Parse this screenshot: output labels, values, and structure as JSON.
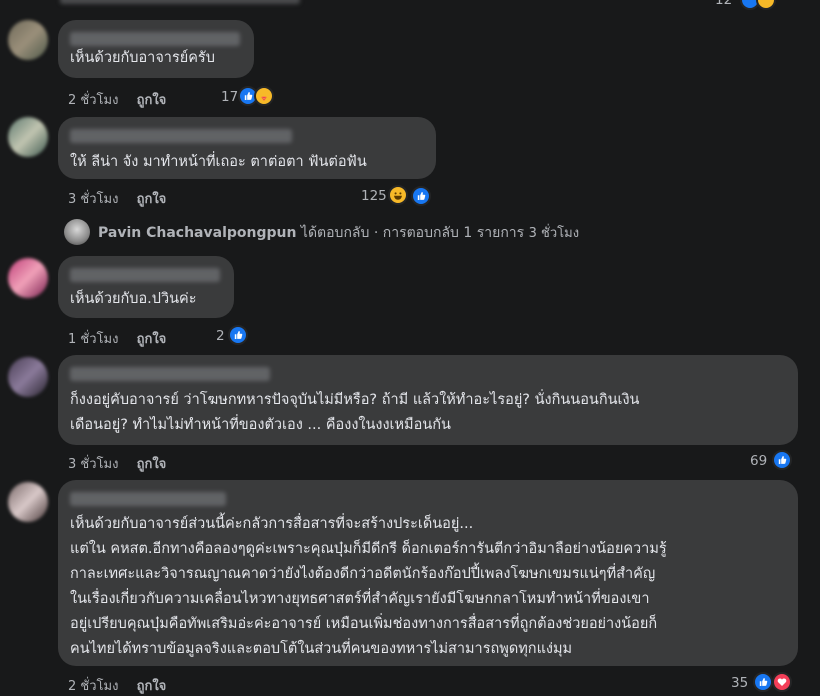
{
  "comments": [
    {
      "text": [
        "เห็นด้วยกับอาจารย์ครับ"
      ],
      "time": "2 ชั่วโมง",
      "like": "ถูกใจ",
      "count": "17"
    },
    {
      "text": [
        "ให้ ลีน่า จัง มาทำหน้าที่เถอะ ตาต่อตา ฟันต่อฟัน"
      ],
      "time": "3 ชั่วโมง",
      "like": "ถูกใจ",
      "count": "125"
    },
    {
      "text": [
        "เห็นด้วยกับอ.ปวินค่ะ"
      ],
      "time": "1 ชั่วโมง",
      "like": "ถูกใจ",
      "count": "2"
    },
    {
      "text": [
        "ก็งงอยู่คับอาจารย์ ว่าโฆษกทหารปัจจุบันไม่มีหรือ? ถ้ามี แล้วให้ทำอะไรอยู่? นั่งกินนอนกินเงิน",
        "เดือนอยู่? ทำไมไม่ทำหน้าที่ของตัวเอง ... คืองงในงงเหมือนกัน"
      ],
      "time": "3 ชั่วโมง",
      "like": "ถูกใจ",
      "count": "69"
    },
    {
      "text": [
        "เห็นด้วยกับอาจารย์ส่วนนี้ค่ะกลัวการสื่อสารที่จะสร้างประเด็นอยู่...",
        "แต่ใน คหสต.อีกทางคือลองๆดูค่ะเพราะคุณบุ๋มก็มีดีกรี ด็อกเตอร์การันตีกว่าอิมาลือย่างน้อยความรู้",
        "กาละเทศะและวิจารณญาณคาดว่ายังไงต้องดีกว่าอดีตนักร้องก๊อปปี้เพลงโฆษกเขมรแน่ๆที่สำคัญ",
        "ในเรื่องเกี่ยวกับความเคลื่อนไหวทางยุทธศาสตร์ที่สำคัญเรายังมีโฆษกกลาโหมทำหน้าที่ของเขา",
        "อยู่เปรียบคุณบุ๋มคือทัพเสริมอ่ะค่ะอาจารย์ เหมือนเพิ่มช่องทางการสื่อสารที่ถูกต้องช่วยอย่างน้อยก็",
        "คนไทยได้ทราบข้อมูลจริงและตอบโต้ในส่วนที่คนของทหารไม่สามารถพูดทุกแง่มุม"
      ],
      "time": "2 ชั่วโมง",
      "like": "ถูกใจ",
      "count": "35"
    }
  ],
  "reply": {
    "name": "Pavin Chachavalpongpun",
    "text": "ได้ตอบกลับ · การตอบกลับ 1 รายการ",
    "time": "3 ชั่วโมง"
  },
  "top_count": "12",
  "colors": {
    "bg": "#18191a",
    "bubble": "#3a3b3c",
    "like": "#1877f2",
    "muted": "#b0b3b8"
  }
}
